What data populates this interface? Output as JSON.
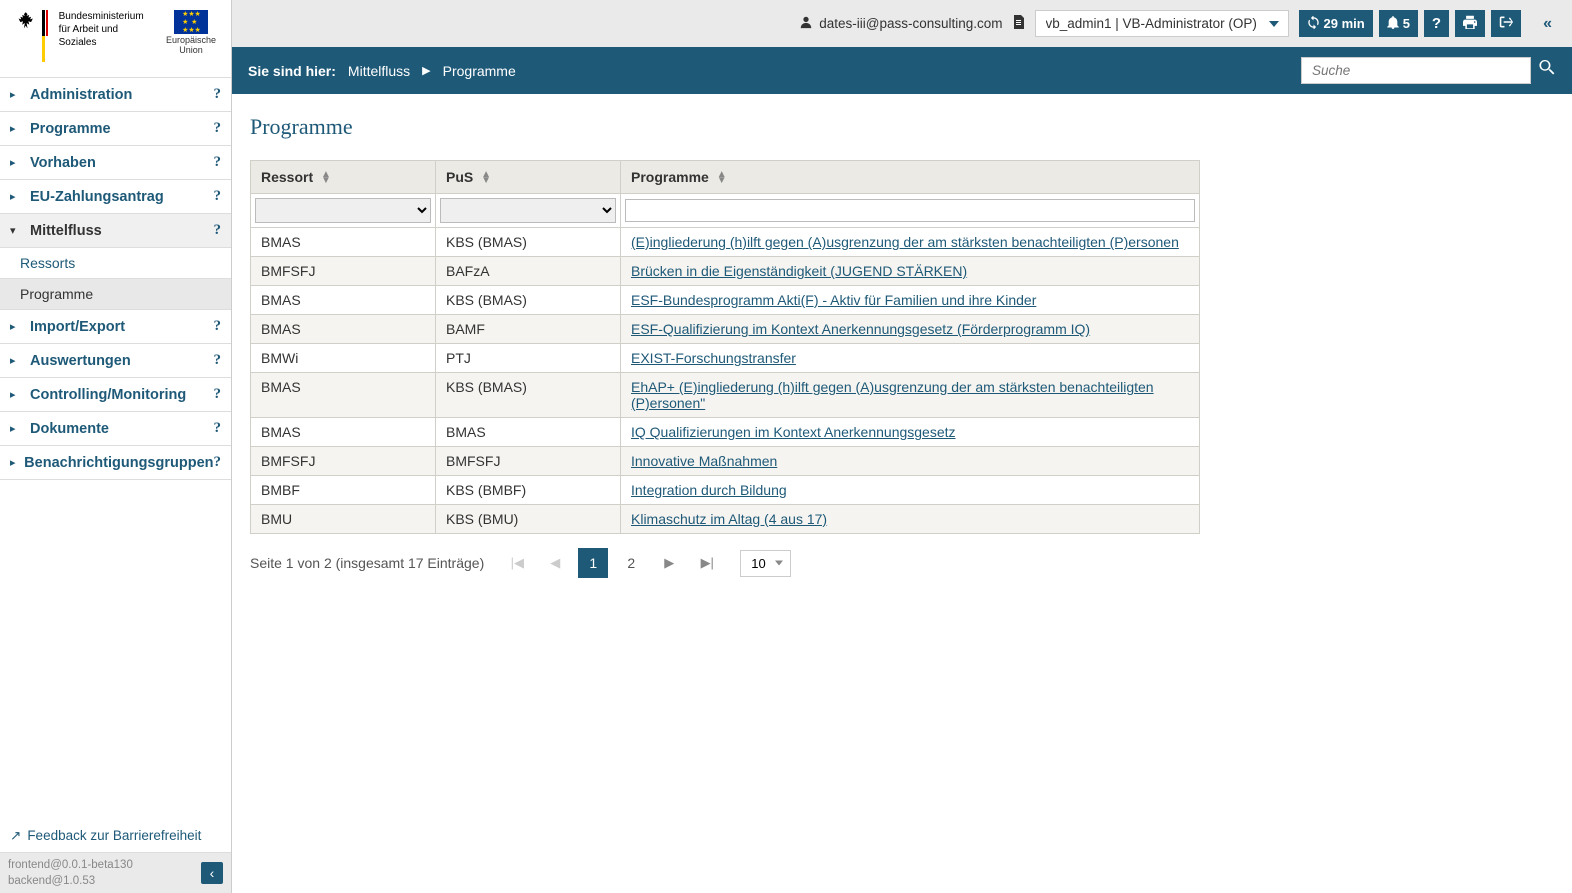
{
  "header": {
    "ministry_line1": "Bundesministerium",
    "ministry_line2": "für Arbeit und Soziales",
    "eu_line1": "Europäische",
    "eu_line2": "Union"
  },
  "sidebar": {
    "items": [
      {
        "label": "Administration"
      },
      {
        "label": "Programme"
      },
      {
        "label": "Vorhaben"
      },
      {
        "label": "EU-Zahlungsantrag"
      },
      {
        "label": "Mittelfluss",
        "active": true
      },
      {
        "label": "Import/Export"
      },
      {
        "label": "Auswertungen"
      },
      {
        "label": "Controlling/Monitoring"
      },
      {
        "label": "Dokumente"
      },
      {
        "label": "Benachrichtigungsgruppen"
      }
    ],
    "sub": [
      {
        "label": "Ressorts"
      },
      {
        "label": "Programme",
        "current": true
      }
    ],
    "feedback": "Feedback zur Barrierefreiheit",
    "frontend_version": "frontend@0.0.1-beta130",
    "backend_version": "backend@1.0.53"
  },
  "topbar": {
    "email": "dates-iii@pass-consulting.com",
    "role": "vb_admin1 | VB-Administrator (OP)",
    "refresh": "29 min",
    "notifications": "5"
  },
  "breadcrumb": {
    "label": "Sie sind hier:",
    "items": [
      "Mittelfluss",
      "Programme"
    ],
    "search_placeholder": "Suche"
  },
  "page": {
    "title": "Programme",
    "columns": {
      "ressort": "Ressort",
      "pus": "PuS",
      "programme": "Programme"
    },
    "rows": [
      {
        "ressort": "BMAS",
        "pus": "KBS (BMAS)",
        "programme": "(E)ingliederung (h)ilft gegen (A)usgrenzung der am stärksten benachteiligten (P)ersonen"
      },
      {
        "ressort": "BMFSFJ",
        "pus": "BAFzA",
        "programme": "Brücken in die Eigenständigkeit (JUGEND STÄRKEN)"
      },
      {
        "ressort": "BMAS",
        "pus": "KBS (BMAS)",
        "programme": "ESF-Bundesprogramm Akti(F) - Aktiv für Familien und ihre Kinder"
      },
      {
        "ressort": "BMAS",
        "pus": "BAMF",
        "programme": "ESF-Qualifizierung im Kontext Anerkennungsgesetz (Förderprogramm IQ)"
      },
      {
        "ressort": "BMWi",
        "pus": "PTJ",
        "programme": "EXIST-Forschungstransfer"
      },
      {
        "ressort": "BMAS",
        "pus": "KBS (BMAS)",
        "programme": "EhAP+ (E)ingliederung (h)ilft gegen (A)usgrenzung der am stärksten benachteiligten (P)ersonen\""
      },
      {
        "ressort": "BMAS",
        "pus": "BMAS",
        "programme": "IQ Qualifizierungen im Kontext Anerkennungsgesetz"
      },
      {
        "ressort": "BMFSFJ",
        "pus": "BMFSFJ",
        "programme": "Innovative Maßnahmen"
      },
      {
        "ressort": "BMBF",
        "pus": "KBS (BMBF)",
        "programme": "Integration durch Bildung"
      },
      {
        "ressort": "BMU",
        "pus": "KBS (BMU)",
        "programme": "Klimaschutz im Altag (4 aus 17)"
      }
    ],
    "pagination": {
      "info": "Seite 1 von 2 (insgesamt 17 Einträge)",
      "current": "1",
      "other": "2",
      "page_size": "10"
    }
  }
}
